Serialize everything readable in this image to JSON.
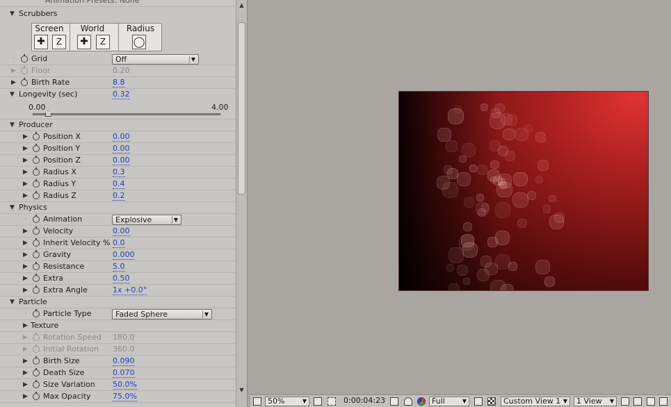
{
  "panel": {
    "top_row": "Animation Presets: None",
    "scrubbers": {
      "title": "Scrubbers",
      "screen_label": "Screen",
      "world_label": "World",
      "radius_label": "Radius",
      "z": "Z"
    },
    "grid": {
      "label": "Grid",
      "value": "Off"
    },
    "floor": {
      "label": "Floor",
      "value": "0.20"
    },
    "birth_rate": {
      "label": "Birth Rate",
      "value": "8.8"
    },
    "longevity": {
      "label": "Longevity (sec)",
      "value": "0.32",
      "min": "0.00",
      "max": "4.00",
      "fraction": 0.08
    },
    "producer": {
      "title": "Producer",
      "items": [
        {
          "label": "Position X",
          "value": "0.00"
        },
        {
          "label": "Position Y",
          "value": "0.00"
        },
        {
          "label": "Position Z",
          "value": "0.00"
        },
        {
          "label": "Radius X",
          "value": "0.3"
        },
        {
          "label": "Radius Y",
          "value": "0.4"
        },
        {
          "label": "Radius Z",
          "value": "0.2"
        }
      ]
    },
    "physics": {
      "title": "Physics",
      "animation": {
        "label": "Animation",
        "value": "Explosive"
      },
      "items": [
        {
          "label": "Velocity",
          "value": "0.00"
        },
        {
          "label": "Inherit Velocity %",
          "value": "0.0"
        },
        {
          "label": "Gravity",
          "value": "0.000"
        },
        {
          "label": "Resistance",
          "value": "5.0"
        },
        {
          "label": "Extra",
          "value": "0.50"
        },
        {
          "label": "Extra Angle",
          "value": "1x +0.0°"
        }
      ]
    },
    "particle": {
      "title": "Particle",
      "particle_type": {
        "label": "Particle Type",
        "value": "Faded Sphere"
      },
      "texture": "Texture",
      "rotation_speed": {
        "label": "Rotation Speed",
        "value": "180.0"
      },
      "initial_rotation": {
        "label": "Initial Rotation",
        "value": "360.0"
      },
      "birth_size": {
        "label": "Birth Size",
        "value": "0.090"
      },
      "death_size": {
        "label": "Death Size",
        "value": "0.070"
      },
      "size_variation": {
        "label": "Size Variation",
        "value": "50.0%"
      },
      "max_opacity": {
        "label": "Max Opacity",
        "value": "75.0%"
      }
    }
  },
  "viewer": {
    "zoom": "50%",
    "timecode": "0:00:04:23",
    "resolution": "Full",
    "camera_view": "Custom View 1",
    "view_layout": "1 View"
  },
  "colors": {
    "value_blue": "#1d3fb8",
    "panel_bg": "#c8c6c4",
    "viewer_bg": "#a9a6a2",
    "comp_red": "#e03333"
  }
}
